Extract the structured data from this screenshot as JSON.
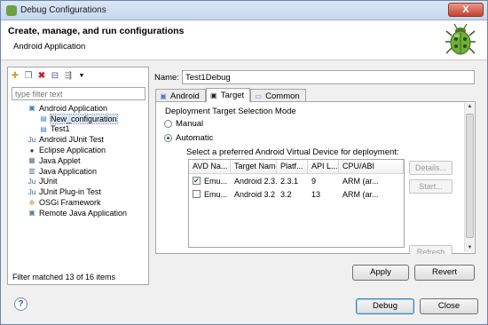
{
  "window": {
    "title": "Debug Configurations",
    "close_label": "X"
  },
  "header": {
    "title": "Create, manage, and run configurations",
    "subtitle": "Android Application"
  },
  "left": {
    "filter_placeholder": "type filter text",
    "tree": [
      {
        "label": "Android Application",
        "indent": 1,
        "icon": "android-app-icon",
        "glyph": "▣"
      },
      {
        "label": "New_configuration",
        "indent": 2,
        "icon": "config-icon",
        "glyph": "▤",
        "selected": true
      },
      {
        "label": "Test1",
        "indent": 2,
        "icon": "config-icon",
        "glyph": "▤"
      },
      {
        "label": "Android JUnit Test",
        "indent": 1,
        "icon": "junit-icon",
        "glyph": "Ju"
      },
      {
        "label": "Eclipse Application",
        "indent": 1,
        "icon": "eclipse-icon",
        "glyph": "●"
      },
      {
        "label": "Java Applet",
        "indent": 1,
        "icon": "applet-icon",
        "glyph": "▦"
      },
      {
        "label": "Java Application",
        "indent": 1,
        "icon": "java-app-icon",
        "glyph": "▥"
      },
      {
        "label": "JUnit",
        "indent": 1,
        "icon": "junit-icon",
        "glyph": "Ju"
      },
      {
        "label": "JUnit Plug-in Test",
        "indent": 1,
        "icon": "junit-plugin-icon",
        "glyph": "Ju"
      },
      {
        "label": "OSGi Framework",
        "indent": 1,
        "icon": "osgi-icon",
        "glyph": "✲"
      },
      {
        "label": "Remote Java Application",
        "indent": 1,
        "icon": "remote-icon",
        "glyph": "▣"
      }
    ],
    "footer": "Filter matched 13 of 16 items"
  },
  "config": {
    "name_label": "Name:",
    "name_value": "Test1Debug",
    "tabs": [
      {
        "label": "Android",
        "icon": "android-tab-icon",
        "glyph": "▣"
      },
      {
        "label": "Target",
        "icon": "target-tab-icon",
        "glyph": "▣",
        "active": true
      },
      {
        "label": "Common",
        "icon": "common-tab-icon",
        "glyph": "▭"
      }
    ],
    "section_title": "Deployment Target Selection Mode",
    "manual_label": "Manual",
    "automatic_label": "Automatic",
    "avd_prompt": "Select a preferred Android Virtual Device for deployment:",
    "columns": [
      "AVD Na...",
      "Target Name",
      "Platf...",
      "API L...",
      "CPU/ABI"
    ],
    "rows": [
      {
        "checked": true,
        "cells": [
          "Emu...",
          "Android 2.3.1",
          "2.3.1",
          "9",
          "ARM (ar..."
        ]
      },
      {
        "checked": false,
        "cells": [
          "Emu...",
          "Android 3.2",
          "3.2",
          "13",
          "ARM (ar..."
        ]
      }
    ],
    "side_buttons": [
      "Details...",
      "Start...",
      "Refresh"
    ],
    "apply_label": "Apply",
    "revert_label": "Revert"
  },
  "footer": {
    "help_label": "?",
    "debug_label": "Debug",
    "close_label": "Close"
  }
}
